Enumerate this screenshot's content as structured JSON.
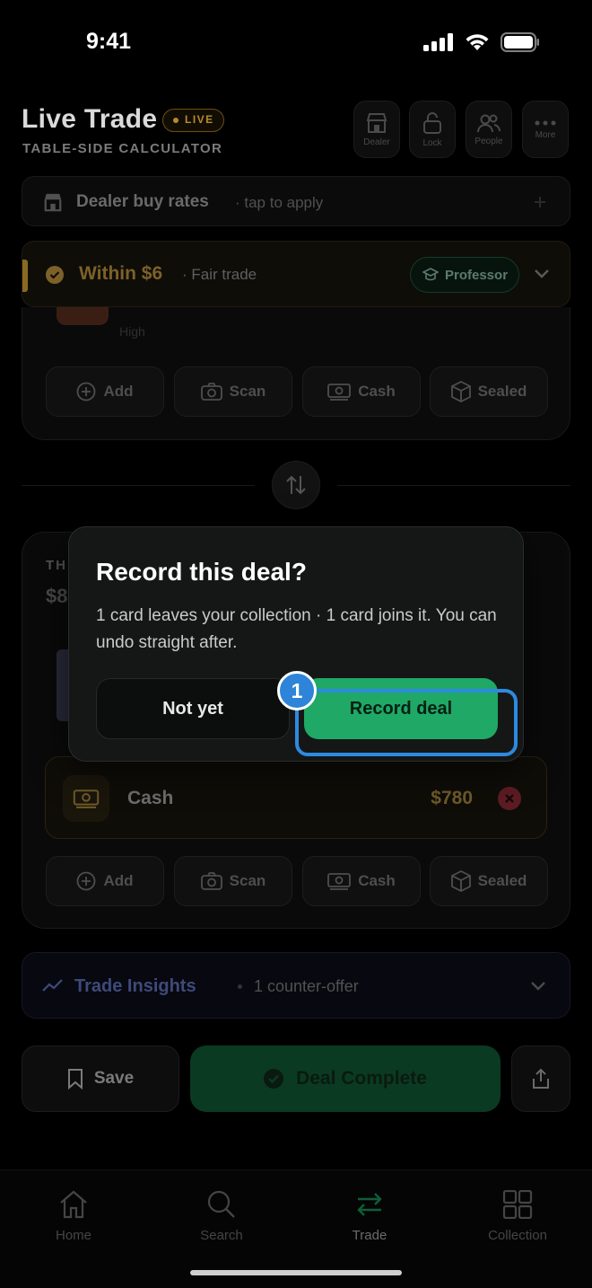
{
  "status_bar": {
    "time": "9:41"
  },
  "header": {
    "title": "Live Trade",
    "live_badge": "LIVE",
    "subtitle": "TABLE-SIDE CALCULATOR",
    "buttons": [
      {
        "label": "Dealer",
        "icon": "store-icon"
      },
      {
        "label": "Lock",
        "icon": "lock-icon"
      },
      {
        "label": "People",
        "icon": "people-icon"
      },
      {
        "label": "More",
        "icon": "more-icon"
      }
    ]
  },
  "dealer_rates": {
    "label": "Dealer buy rates",
    "hint": "· tap to apply"
  },
  "fairness": {
    "value": "Within $6",
    "label": "· Fair trade",
    "mode": "Professor"
  },
  "top_panel": {
    "card_condition": "High",
    "actions": [
      {
        "label": "Add",
        "icon": "plus-circle-icon"
      },
      {
        "label": "Scan",
        "icon": "camera-icon"
      },
      {
        "label": "Cash",
        "icon": "cash-icon"
      },
      {
        "label": "Sealed",
        "icon": "box-icon"
      }
    ]
  },
  "bottom_panel": {
    "section_label_partial": "TH",
    "value_partial": "$8",
    "cash_row": {
      "label": "Cash",
      "amount": "$780"
    },
    "actions": [
      {
        "label": "Add",
        "icon": "plus-circle-icon"
      },
      {
        "label": "Scan",
        "icon": "camera-icon"
      },
      {
        "label": "Cash",
        "icon": "cash-icon"
      },
      {
        "label": "Sealed",
        "icon": "box-icon"
      }
    ]
  },
  "insights": {
    "label": "Trade Insights",
    "sub": "1 counter-offer"
  },
  "bottom_actions": {
    "save": "Save",
    "deal_complete": "Deal Complete"
  },
  "tabbar": [
    {
      "label": "Home",
      "icon": "home-icon"
    },
    {
      "label": "Search",
      "icon": "search-icon"
    },
    {
      "label": "Trade",
      "icon": "swap-icon",
      "active": true
    },
    {
      "label": "Collection",
      "icon": "grid-icon"
    }
  ],
  "modal": {
    "title": "Record this deal?",
    "body": "1 card leaves your collection · 1 card joins it. You can undo straight after.",
    "cancel": "Not yet",
    "confirm": "Record deal"
  },
  "annotation": {
    "marker": "1"
  },
  "colors": {
    "accent_green": "#1fa866",
    "highlight_blue": "#2d8ae0",
    "gold": "#b88a2e"
  }
}
